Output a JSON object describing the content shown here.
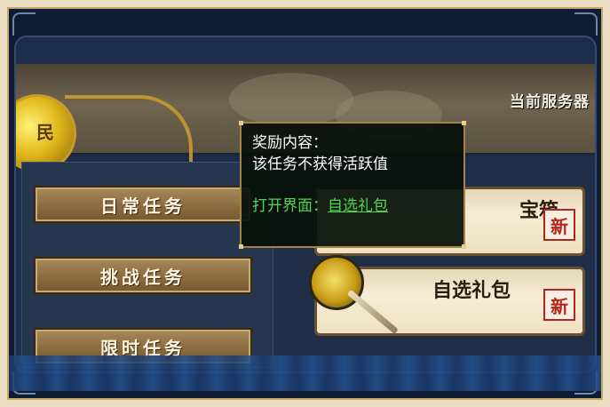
{
  "header": {
    "server_label": "当前服务器"
  },
  "banner": {
    "medallion_char": "民"
  },
  "tasks": [
    {
      "label": "日常任务"
    },
    {
      "label": "挑战任务"
    },
    {
      "label": "限时任务"
    }
  ],
  "rewards": [
    {
      "title": "宝箱",
      "badge": "新"
    },
    {
      "title": "自选礼包",
      "badge": "新"
    }
  ],
  "tooltip": {
    "title": "奖励内容：",
    "description": "该任务不获得活跃值",
    "open_label": "打开界面：",
    "open_link": "自选礼包"
  },
  "icons": [
    "gift-icon",
    "wand-icon",
    "medallion-icon"
  ],
  "colors": {
    "accent_gold": "#c89a2e",
    "link_green": "#4fd64f",
    "new_red": "#b3261e"
  }
}
